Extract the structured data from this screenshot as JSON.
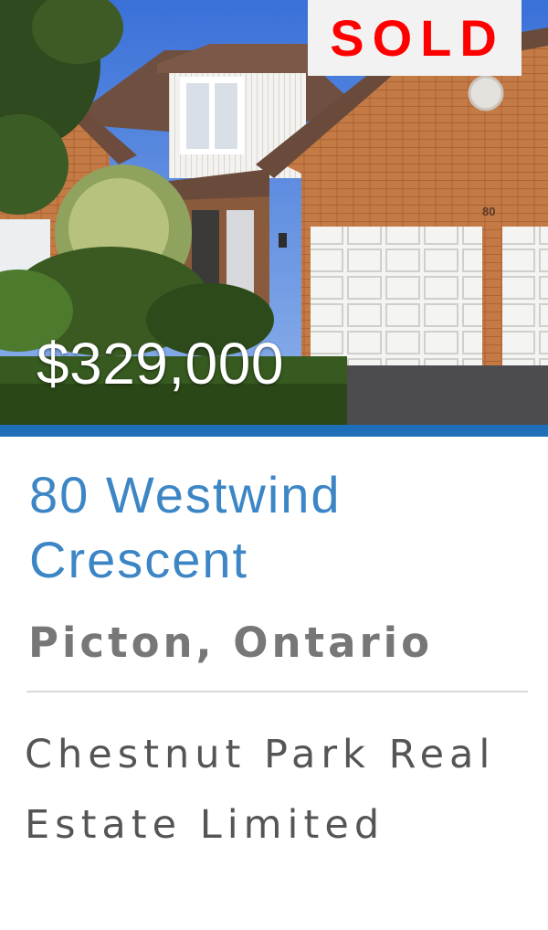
{
  "listing": {
    "status_badge": "SOLD",
    "price": "$329,000",
    "address": "80 Westwind Crescent",
    "city": "Picton, Ontario",
    "brokerage": "Chestnut Park Real Estate Limited",
    "house_number": "80"
  },
  "colors": {
    "accent": "#1f6fb8",
    "address_text": "#3d86c6",
    "sold_text": "#ff0000",
    "sold_background": "#f2f2f2",
    "muted_text": "#777777"
  },
  "icons": {
    "photo": "house-photo"
  }
}
